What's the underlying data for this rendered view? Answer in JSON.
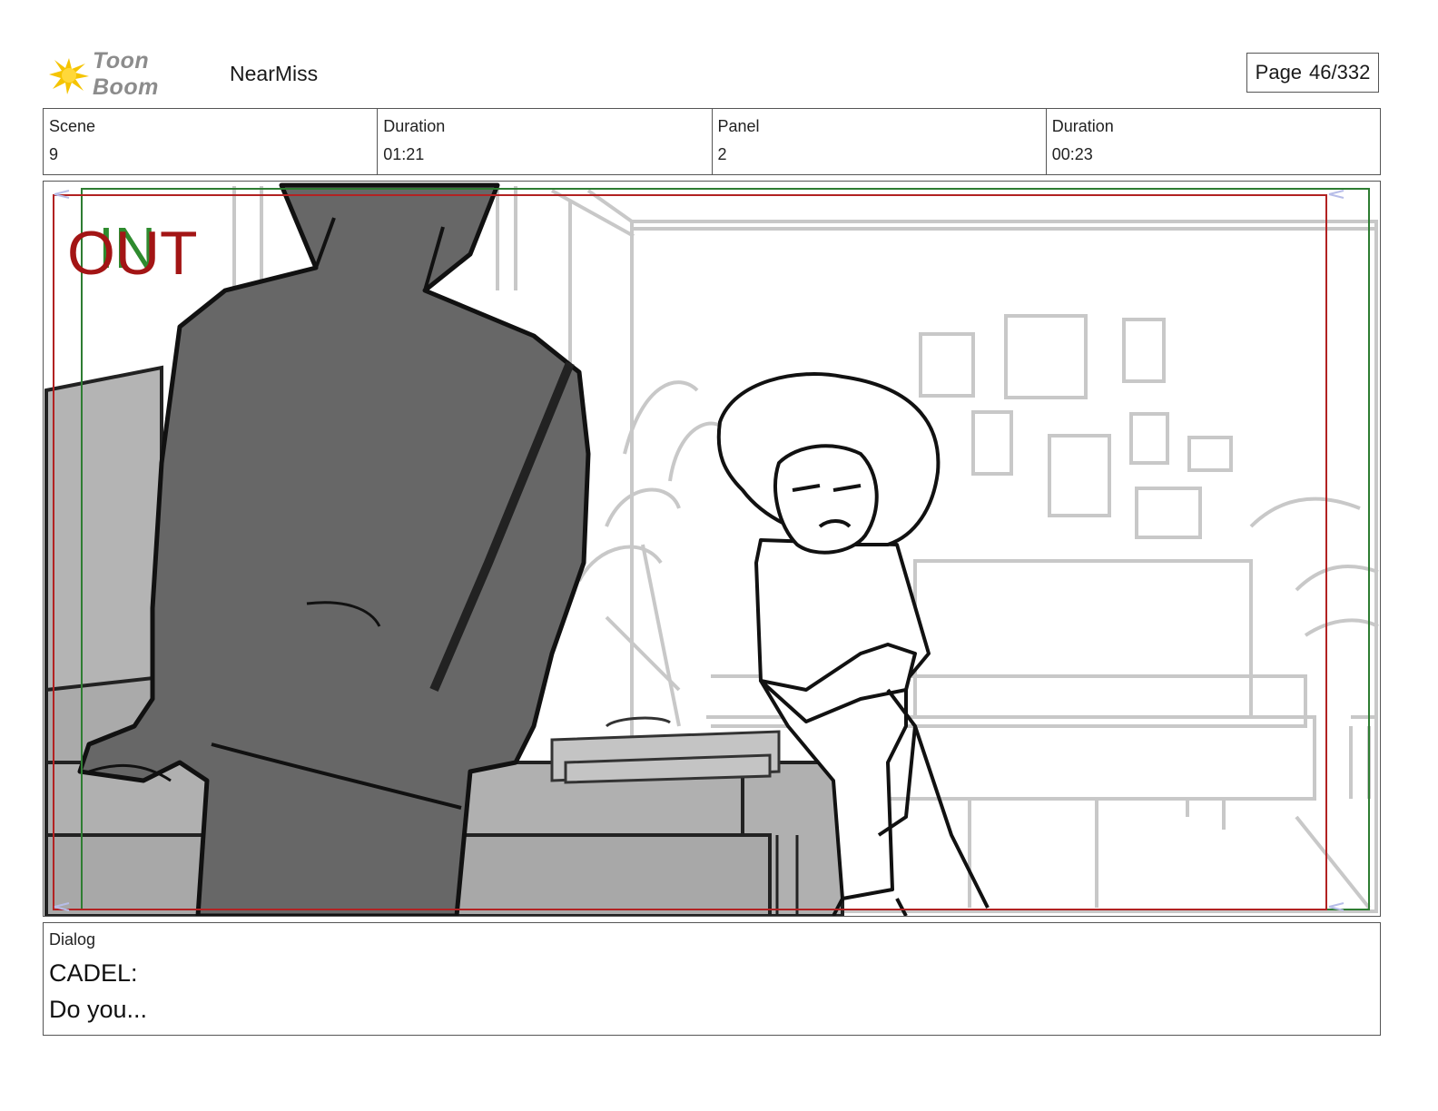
{
  "header": {
    "logo_text": "Toon Boom",
    "project": "NearMiss",
    "page_label": "Page",
    "page_value": "46/332"
  },
  "info": {
    "scene_label": "Scene",
    "scene_value": "9",
    "duration_label": "Duration",
    "duration_value": "01:21",
    "panel_label": "Panel",
    "panel_value": "2",
    "panel_duration_label": "Duration",
    "panel_duration_value": "00:23"
  },
  "panel": {
    "in_label": "IN",
    "out_label": "OUT",
    "colors": {
      "in": "#2e8b2e",
      "out": "#a31515",
      "frame_green": "#2e7d32",
      "frame_red": "#b22222"
    }
  },
  "dialog": {
    "label": "Dialog",
    "character": "CADEL:",
    "line": "Do you..."
  }
}
